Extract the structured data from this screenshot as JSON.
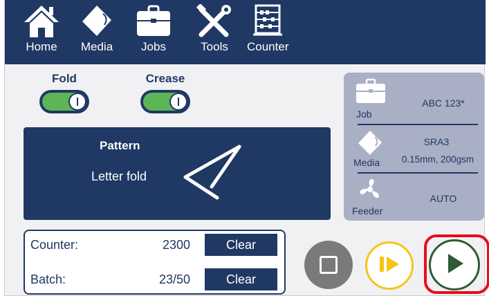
{
  "nav": {
    "items": [
      {
        "label": "Home",
        "icon": "home-icon"
      },
      {
        "label": "Media",
        "icon": "media-icon"
      },
      {
        "label": "Jobs",
        "icon": "briefcase-icon"
      },
      {
        "label": "Tools",
        "icon": "tools-icon"
      },
      {
        "label": "Counter",
        "icon": "abacus-icon"
      }
    ]
  },
  "toggles": {
    "fold": {
      "label": "Fold",
      "on": true
    },
    "crease": {
      "label": "Crease",
      "on": true
    }
  },
  "pattern": {
    "title": "Pattern",
    "name": "Letter fold"
  },
  "info": {
    "job": {
      "label": "Job",
      "value": "ABC 123*"
    },
    "media": {
      "label": "Media",
      "value_line1": "SRA3",
      "value_line2": "0.15mm, 200gsm"
    },
    "feeder": {
      "label": "Feeder",
      "value": "AUTO"
    }
  },
  "counters": {
    "counter": {
      "label": "Counter:",
      "value": "2300",
      "button": "Clear"
    },
    "batch": {
      "label": "Batch:",
      "value": "23/50",
      "button": "Clear"
    }
  },
  "controls": {
    "stop": "stop-icon",
    "step": "step-icon",
    "play": "play-icon",
    "highlight_color": "#e60d19"
  },
  "colors": {
    "navy": "#1f3864",
    "toggle_on": "#5db556",
    "panel": "#a9afc4",
    "step_accent": "#f5c518",
    "play_accent": "#2e5a37"
  }
}
